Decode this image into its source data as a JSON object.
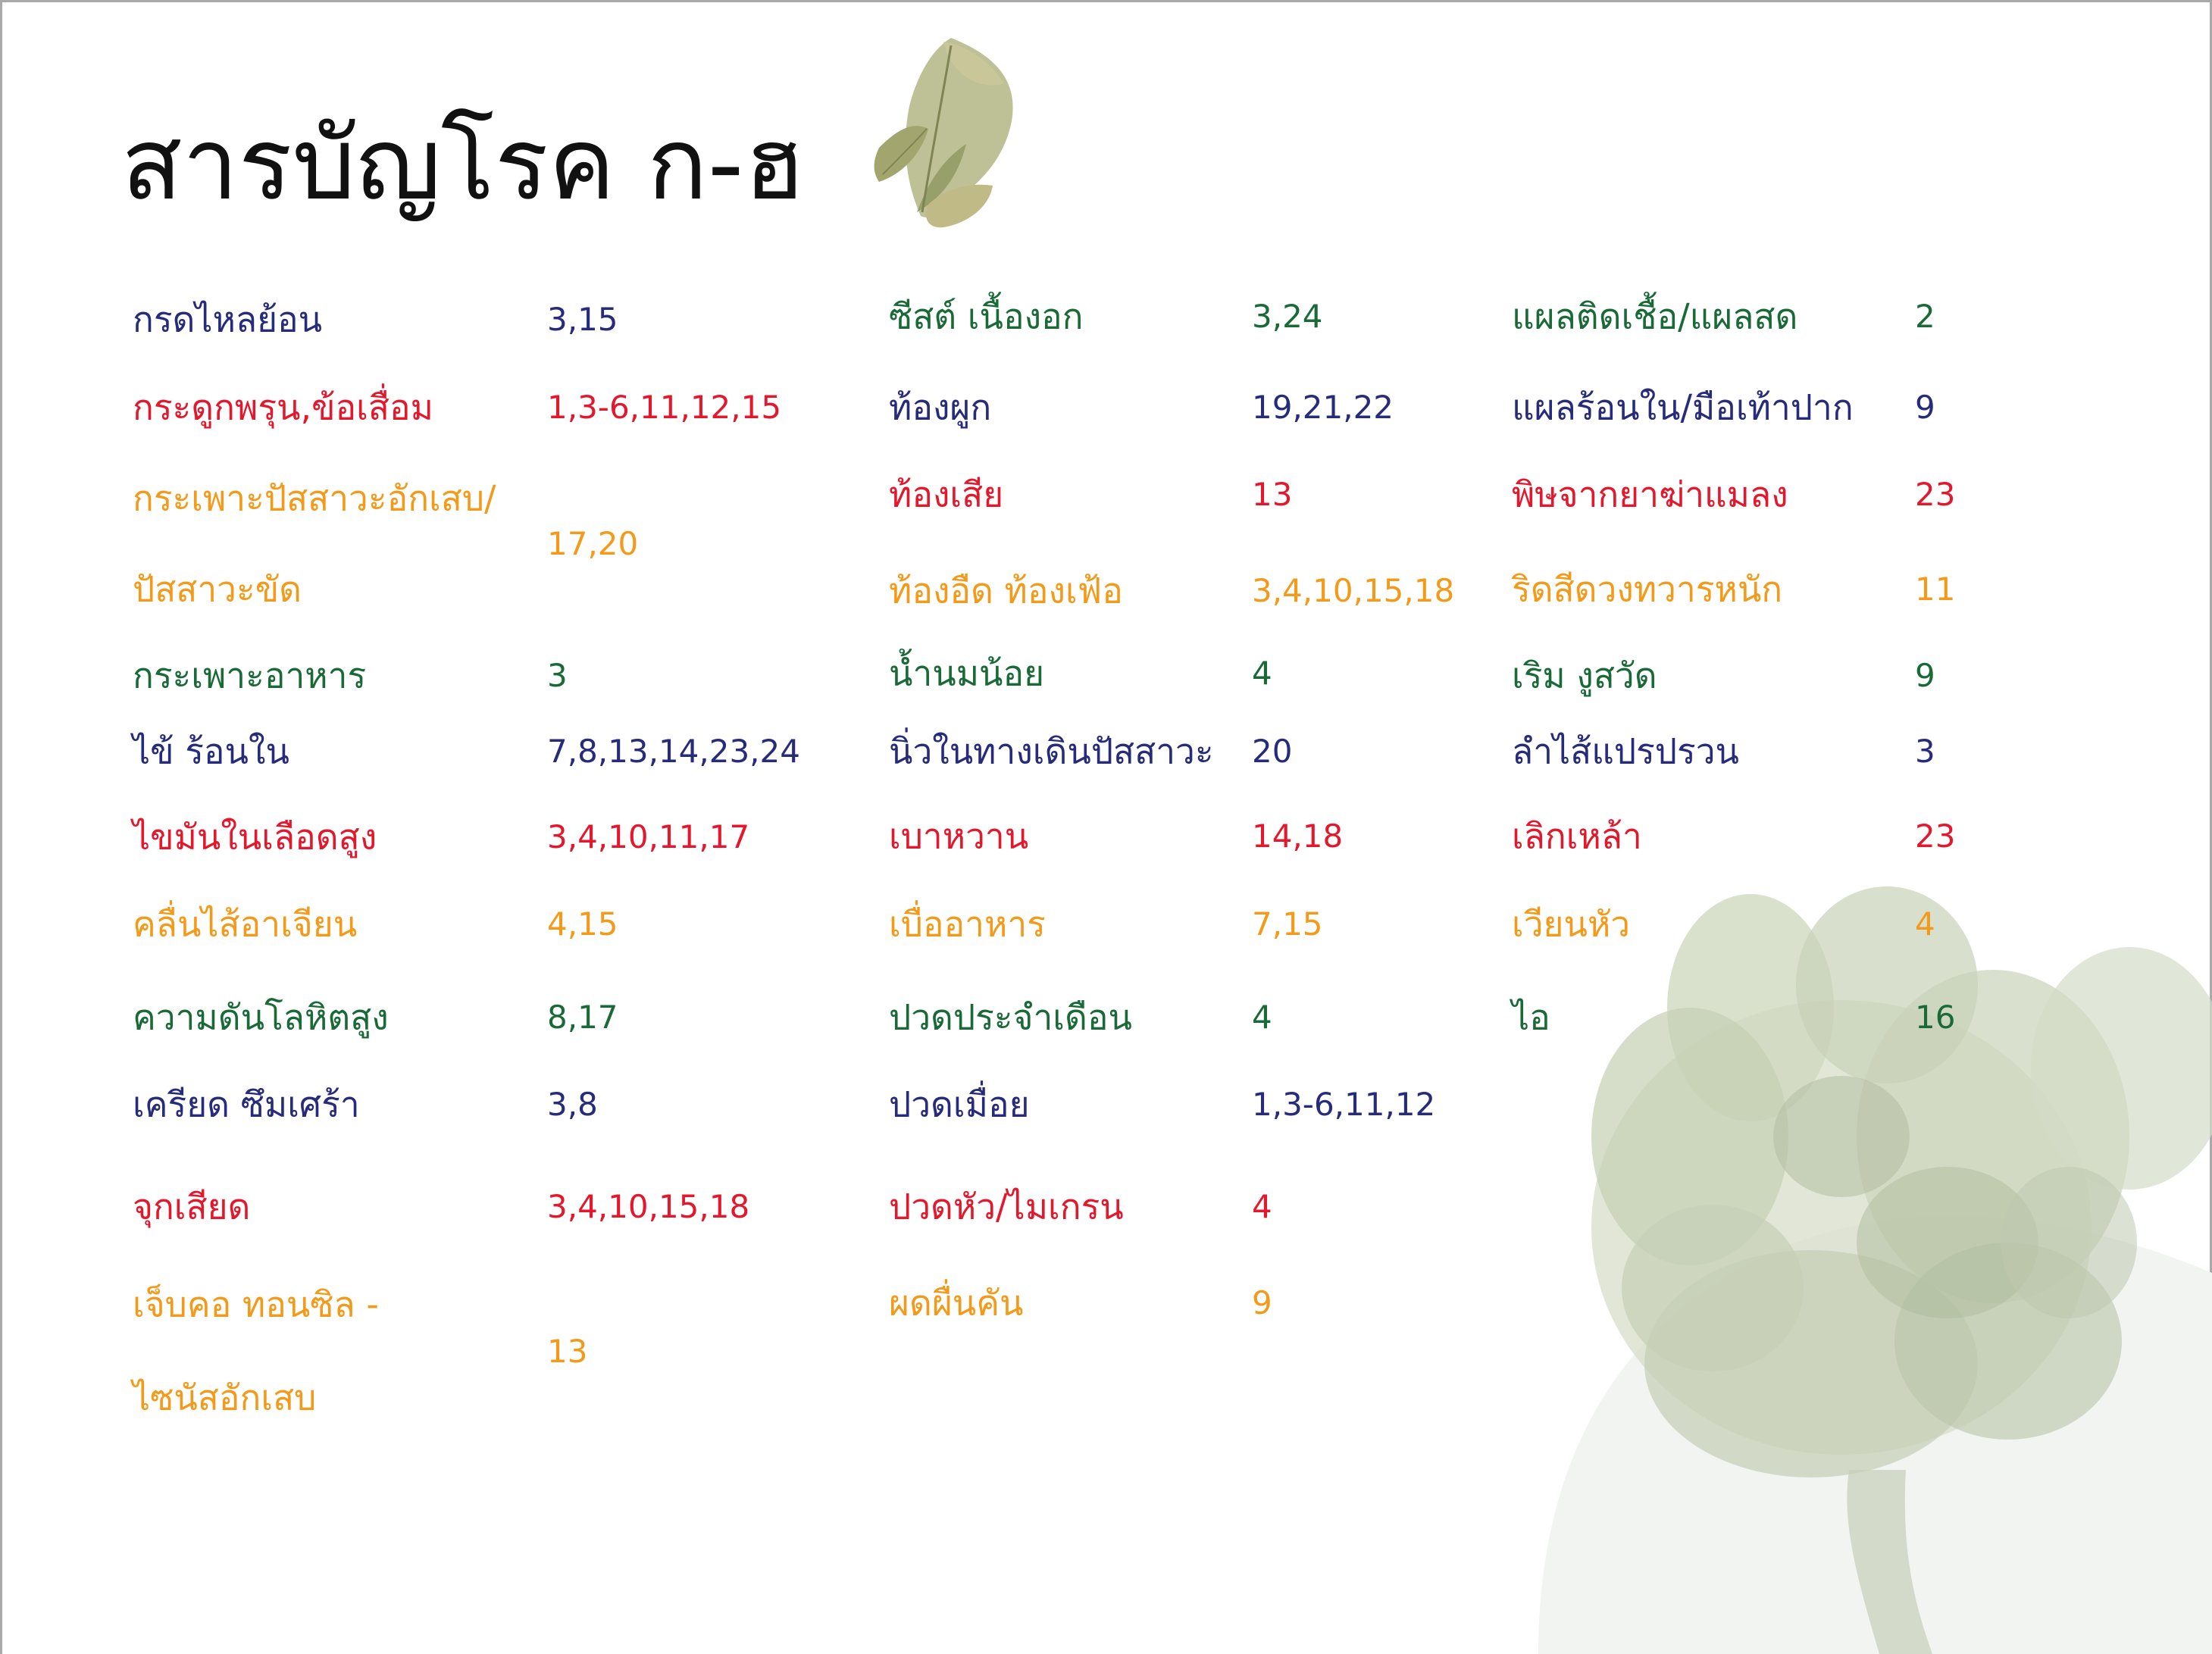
{
  "page_title": "สารบัญโรค ก-ฮ",
  "colors": {
    "navy": "#262b7a",
    "red": "#e3182d",
    "orange": "#f39a1a",
    "green": "#1a6a37",
    "title": "#111111"
  },
  "decorations": [
    "leaf-illustration",
    "herb-bush-illustration"
  ],
  "columns": [
    {
      "entries": [
        {
          "name": "กรดไหลย้อน",
          "pages": "3,15",
          "color": "navy"
        },
        {
          "name": "กระดูกพรุน,ข้อเสื่อม",
          "pages": "1,3-6,11,12,15",
          "color": "red"
        },
        {
          "name": "กระเพาะปัสสาวะอักเสบ/",
          "name2": "ปัสสาวะขัด",
          "pages": "17,20",
          "color": "orange"
        },
        {
          "name": "กระเพาะอาหาร",
          "pages": "3",
          "color": "green"
        },
        {
          "name": "ไข้ ร้อนใน",
          "pages": "7,8,13,14,23,24",
          "color": "navy"
        },
        {
          "name": "ไขมันในเลือดสูง",
          "pages": "3,4,10,11,17",
          "color": "red"
        },
        {
          "name": "คลื่นไส้อาเจียน",
          "pages": "4,15",
          "color": "orange"
        },
        {
          "name": "ความดันโลหิตสูง",
          "pages": "8,17",
          "color": "green"
        },
        {
          "name": "เครียด ซึมเศร้า",
          "pages": "3,8",
          "color": "navy"
        },
        {
          "name": "จุกเสียด",
          "pages": "3,4,10,15,18",
          "color": "red"
        },
        {
          "name": "เจ็บคอ ทอนซิล -",
          "name2": "ไซนัสอักเสบ",
          "pages": "13",
          "color": "orange"
        }
      ]
    },
    {
      "entries": [
        {
          "name": "ซีสต์ เนื้องอก",
          "pages": "3,24",
          "color": "green"
        },
        {
          "name": "ท้องผูก",
          "pages": "19,21,22",
          "color": "navy"
        },
        {
          "name": "ท้องเสีย",
          "pages": "13",
          "color": "red"
        },
        {
          "name": "ท้องอืด ท้องเฟ้อ",
          "pages": "3,4,10,15,18",
          "color": "orange"
        },
        {
          "name": "น้ำนมน้อย",
          "pages": "4",
          "color": "green"
        },
        {
          "name": "นิ่วในทางเดินปัสสาวะ",
          "pages": "20",
          "color": "navy"
        },
        {
          "name": "เบาหวาน",
          "pages": "14,18",
          "color": "red"
        },
        {
          "name": "เบื่ออาหาร",
          "pages": "7,15",
          "color": "orange"
        },
        {
          "name": "ปวดประจำเดือน",
          "pages": "4",
          "color": "green"
        },
        {
          "name": "ปวดเมื่อย",
          "pages": "1,3-6,11,12",
          "color": "navy"
        },
        {
          "name": "ปวดหัว/ไมเกรน",
          "pages": "4",
          "color": "red"
        },
        {
          "name": "ผดผื่นคัน",
          "pages": "9",
          "color": "orange"
        }
      ]
    },
    {
      "entries": [
        {
          "name": "แผลติดเชื้อ/แผลสด",
          "pages": "2",
          "color": "green"
        },
        {
          "name": "แผลร้อนใน/มือเท้าปาก",
          "pages": "9",
          "color": "navy"
        },
        {
          "name": "พิษจากยาฆ่าแมลง",
          "pages": "23",
          "color": "red"
        },
        {
          "name": "ริดสีดวงทวารหนัก",
          "pages": "11",
          "color": "orange"
        },
        {
          "name": "เริม งูสวัด",
          "pages": "9",
          "color": "green"
        },
        {
          "name": "ลำไส้แปรปรวน",
          "pages": "3",
          "color": "navy"
        },
        {
          "name": "เลิกเหล้า",
          "pages": "23",
          "color": "red"
        },
        {
          "name": "เวียนหัว",
          "pages": "4",
          "color": "orange"
        },
        {
          "name": "ไอ",
          "pages": "16",
          "color": "green"
        }
      ]
    }
  ]
}
